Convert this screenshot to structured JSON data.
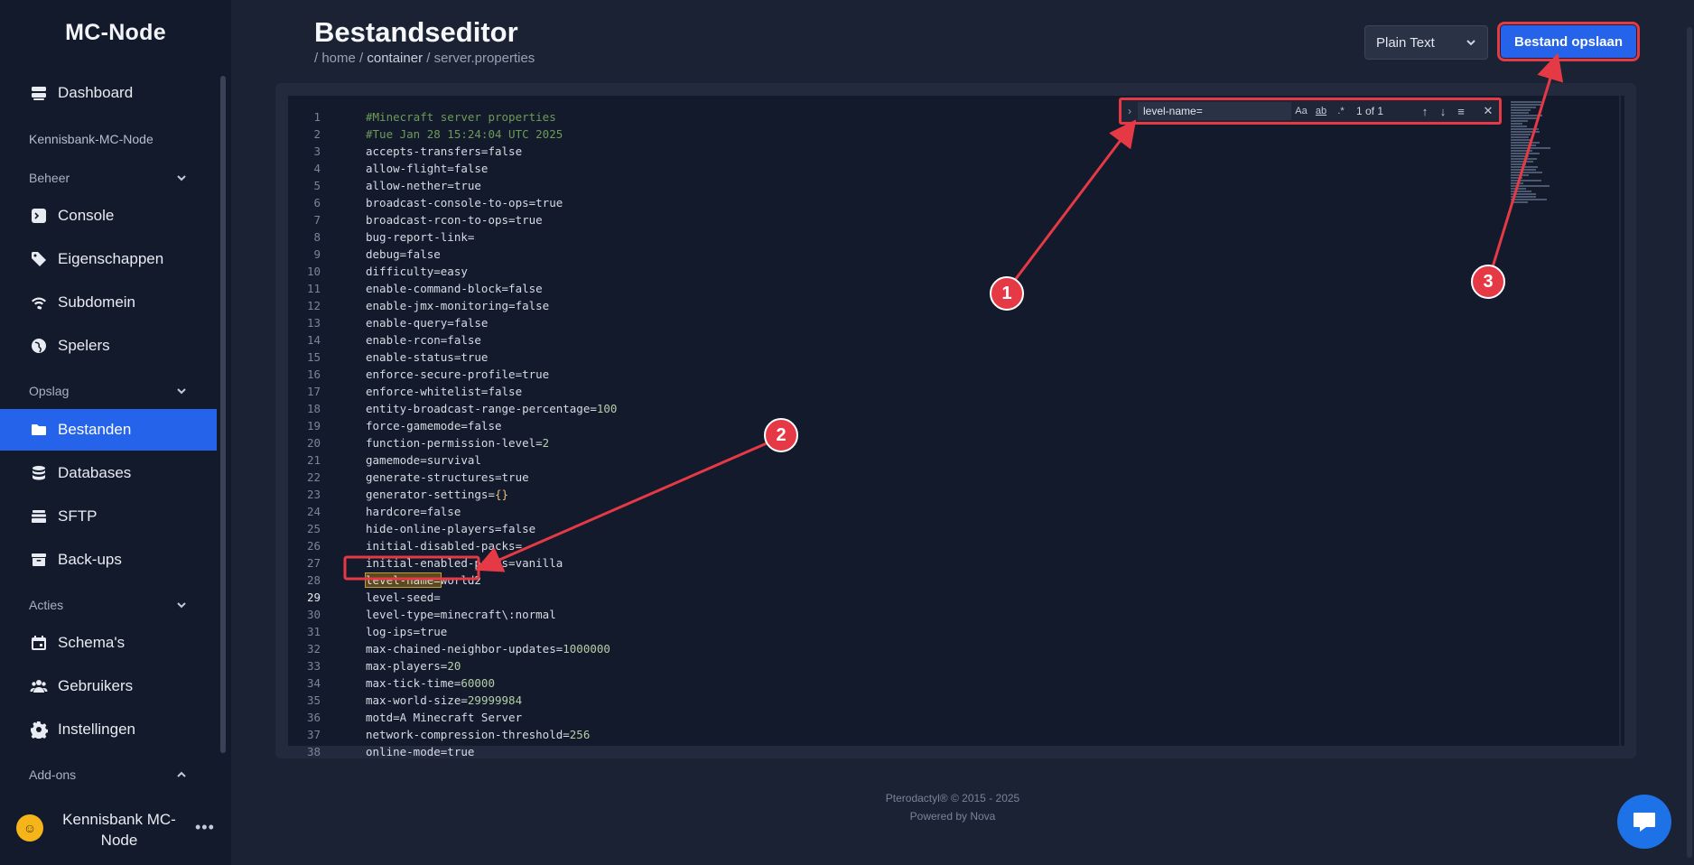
{
  "sidebar": {
    "brand": "MC-Node",
    "items": [
      {
        "label": "Dashboard"
      },
      {
        "label": "Console"
      },
      {
        "label": "Eigenschappen"
      },
      {
        "label": "Subdomein"
      },
      {
        "label": "Spelers"
      },
      {
        "label": "Bestanden"
      },
      {
        "label": "Databases"
      },
      {
        "label": "SFTP"
      },
      {
        "label": "Back-ups"
      },
      {
        "label": "Schema's"
      },
      {
        "label": "Gebruikers"
      },
      {
        "label": "Instellingen"
      }
    ],
    "server_name": "Kennisbank-MC-Node",
    "groups": {
      "beheer": "Beheer",
      "opslag": "Opslag",
      "acties": "Acties",
      "addons": "Add-ons"
    },
    "user": {
      "name": "Kennisbank MC-Node",
      "menu": "•••"
    }
  },
  "header": {
    "title": "Bestandseditor",
    "breadcrumb": {
      "sep1": "/ home / ",
      "part2": "container",
      "sep2": " / ",
      "part3": "server.properties"
    },
    "language": "Plain Text",
    "save_label": "Bestand opslaan"
  },
  "find": {
    "value": "level-name=",
    "match_case": "Aa",
    "whole_word": "ab",
    "regex": ".*",
    "count": "1 of 1",
    "prev": "↑",
    "next": "↓",
    "selection": "≡",
    "close": "✕"
  },
  "code": [
    "#Minecraft server properties",
    "#Tue Jan 28 15:24:04 UTC 2025",
    "accepts-transfers=false",
    "allow-flight=false",
    "allow-nether=true",
    "broadcast-console-to-ops=true",
    "broadcast-rcon-to-ops=true",
    "bug-report-link=",
    "debug=false",
    "difficulty=easy",
    "enable-command-block=false",
    "enable-jmx-monitoring=false",
    "enable-query=false",
    "enable-rcon=false",
    "enable-status=true",
    "enforce-secure-profile=true",
    "enforce-whitelist=false",
    "entity-broadcast-range-percentage=100",
    "force-gamemode=false",
    "function-permission-level=2",
    "gamemode=survival",
    "generate-structures=true",
    "generator-settings={}",
    "hardcore=false",
    "hide-online-players=false",
    "initial-disabled-packs=",
    "initial-enabled-packs=vanilla",
    "level-name=world2",
    "level-seed=",
    "level-type=minecraft\\:normal",
    "log-ips=true",
    "max-chained-neighbor-updates=1000000",
    "max-players=20",
    "max-tick-time=60000",
    "max-world-size=29999984",
    "motd=A Minecraft Server",
    "network-compression-threshold=256",
    "online-mode=true"
  ],
  "current_line": 29,
  "highlight_line": 28,
  "footer": {
    "line1": "Pterodactyl® © 2015 - 2025",
    "line2": "Powered by Nova"
  },
  "annotations": [
    "1",
    "2",
    "3"
  ],
  "colors": {
    "accent": "#2563eb",
    "annotation": "#e63946"
  }
}
